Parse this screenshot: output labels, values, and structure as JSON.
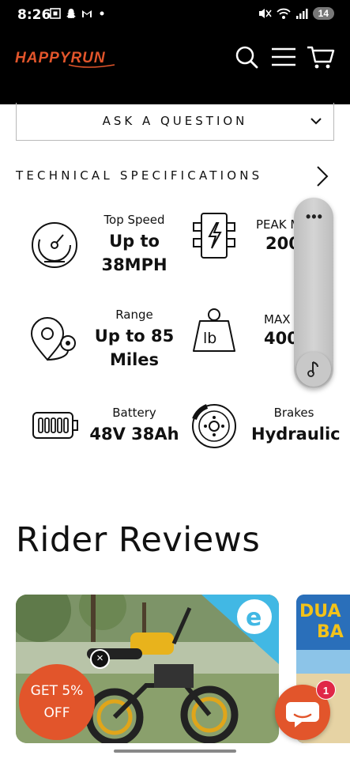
{
  "status_bar": {
    "time": "8:26",
    "notification_count": "14"
  },
  "header": {
    "logo_text": "HAPPYRUN",
    "brand_color": "#e2552b",
    "icons": [
      "search-icon",
      "menu-icon",
      "cart-icon"
    ]
  },
  "ask_question": {
    "label": "ASK A QUESTION"
  },
  "tech_specs": {
    "title": "TECHNICAL SPECIFICATIONS",
    "items": [
      {
        "label": "Top Speed",
        "value_line1": "Up to",
        "value_line2": "38MPH",
        "icon": "speedometer-icon"
      },
      {
        "label": "PEAK M",
        "value_line1": "200",
        "value_line2": "",
        "icon": "motor-power-icon"
      },
      {
        "label": "Range",
        "value_line1": "Up to 85",
        "value_line2": "Miles",
        "icon": "range-map-pin-icon"
      },
      {
        "label": "MAX L",
        "value_line1": "400",
        "value_line2": "",
        "icon": "weight-lb-icon"
      },
      {
        "label": "Battery",
        "value_line1": "48V 38Ah",
        "value_line2": "",
        "icon": "battery-icon"
      },
      {
        "label": "Brakes",
        "value_line1": "Hydraulic",
        "value_line2": "",
        "icon": "disc-brake-icon"
      }
    ]
  },
  "floating_menu": {
    "dots": "•••",
    "icon": "music-note-icon"
  },
  "reviews": {
    "title": "Rider Reviews",
    "card2_text_line1": "DUA",
    "card2_text_line2": "BA"
  },
  "promo": {
    "line1": "GET 5%",
    "line2": "OFF",
    "close_symbol": "×"
  },
  "chat": {
    "badge_count": "1"
  }
}
